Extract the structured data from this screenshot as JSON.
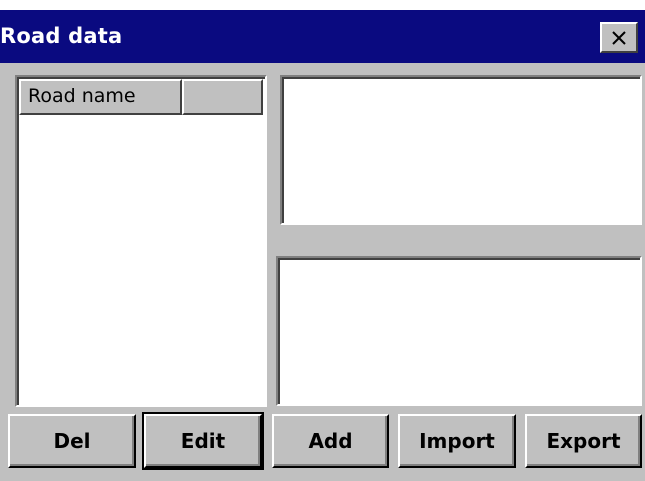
{
  "window": {
    "title": "Road data",
    "close_symbol": "×"
  },
  "listview": {
    "columns": [
      "Road name",
      ""
    ]
  },
  "buttons": {
    "del": "Del",
    "edit": "Edit",
    "add": "Add",
    "import": "Import",
    "export": "Export"
  },
  "icons": {
    "close": "close-icon"
  },
  "colors": {
    "titlebar": "#0a0a80",
    "face": "#c0c0c0",
    "field": "#ffffff"
  }
}
